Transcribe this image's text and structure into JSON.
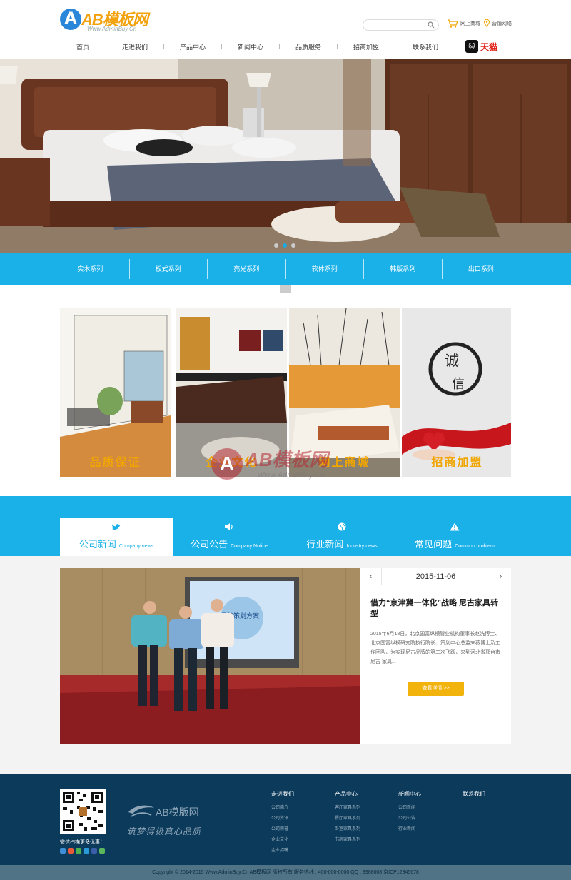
{
  "header": {
    "logo_main": "AB模板网",
    "logo_sub": "Www.AdminBuy.Cn",
    "logo_letter": "A",
    "search_placeholder": "",
    "cart_label": "网上商城",
    "location_label": "营销网络",
    "tmall_label": "天猫"
  },
  "nav": {
    "items": [
      {
        "label": "首页"
      },
      {
        "label": "走进我们"
      },
      {
        "label": "产品中心"
      },
      {
        "label": "新闻中心"
      },
      {
        "label": "品质服务"
      },
      {
        "label": "招商加盟"
      },
      {
        "label": "联系我们"
      }
    ]
  },
  "categories": [
    {
      "label": "实木系列"
    },
    {
      "label": "板式系列"
    },
    {
      "label": "亮光系列"
    },
    {
      "label": "软体系列"
    },
    {
      "label": "韩版系列"
    },
    {
      "label": "出口系列"
    }
  ],
  "features": [
    {
      "label": "品质保证"
    },
    {
      "label": "企业文化"
    },
    {
      "label": "网上商城"
    },
    {
      "label": "招商加盟"
    }
  ],
  "watermark": {
    "letter": "A",
    "text": "AB模板网",
    "sub": "Www.AdminBuy.Cn"
  },
  "news_tabs": [
    {
      "cn": "公司新闻",
      "en": "Company news",
      "icon": "bird-icon"
    },
    {
      "cn": "公司公告",
      "en": "Company Notice",
      "icon": "speaker-icon"
    },
    {
      "cn": "行业新闻",
      "en": "Industry news",
      "icon": "globe-icon"
    },
    {
      "cn": "常见问题",
      "en": "Common problem",
      "icon": "warning-icon"
    }
  ],
  "news": {
    "date": "2015-11-06",
    "prev": "‹",
    "next": "›",
    "title": "借力“京津冀一体化”战略 尼古家具转型",
    "body": "2015年6月18日，北京国富纵横管业机构董事长赵洗博士、北京国富纵横研究院执行院长、策划中心总监宋薇博士及工作团队，为实现尼古品牌的第二次飞跃，来到河北省邢台市 尼古 家具...",
    "button": "查看详情 >>",
    "slide_text": "品牌策划方案"
  },
  "footer": {
    "qr_caption": "微信扫描更多优惠！",
    "logo_text": "AB模版网",
    "slogan": "筑梦得极真心品质",
    "columns": [
      {
        "title": "走进我们",
        "links": [
          "公司简介",
          "公司资讯",
          "公司荣誉",
          "企业文化",
          "企业招聘"
        ]
      },
      {
        "title": "产品中心",
        "links": [
          "客厅家具系列",
          "餐厅家具系列",
          "卧室家具系列",
          "书房家具系列"
        ]
      },
      {
        "title": "新闻中心",
        "links": [
          "公司新闻",
          "公司公告",
          "行业新闻"
        ]
      },
      {
        "title": "联系我们",
        "links": []
      }
    ],
    "copyright": "Copyright © 2014-2015 Www.AdminBuy.Cn AB模板网 版权所有    服务热线 : 400-000-0000    QQ : 9988008    京ICP12345678"
  },
  "colors": {
    "accent": "#1ab0e8",
    "orange": "#f0a500",
    "footer_bg": "#0b3a5a",
    "button": "#f3b30d"
  }
}
